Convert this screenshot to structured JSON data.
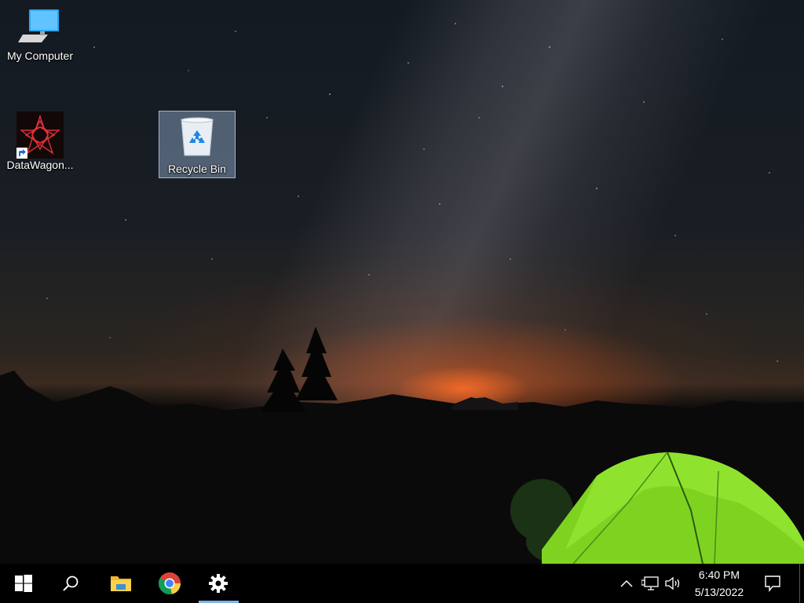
{
  "desktop": {
    "icons": [
      {
        "label": "My Computer"
      },
      {
        "label": "DataWagon..."
      },
      {
        "label": "Recycle Bin"
      }
    ]
  },
  "taskbar": {
    "start": {
      "icon": "windows-logo-icon"
    },
    "search": {
      "icon": "search-icon"
    },
    "apps": [
      {
        "icon": "file-explorer-icon"
      },
      {
        "icon": "chrome-icon"
      },
      {
        "icon": "settings-gear-icon",
        "active": true
      }
    ],
    "tray": {
      "time": "6:40 PM",
      "date": "5/13/2022"
    },
    "colors": {
      "accent": "#7fb2e6",
      "background": "#000000"
    }
  }
}
